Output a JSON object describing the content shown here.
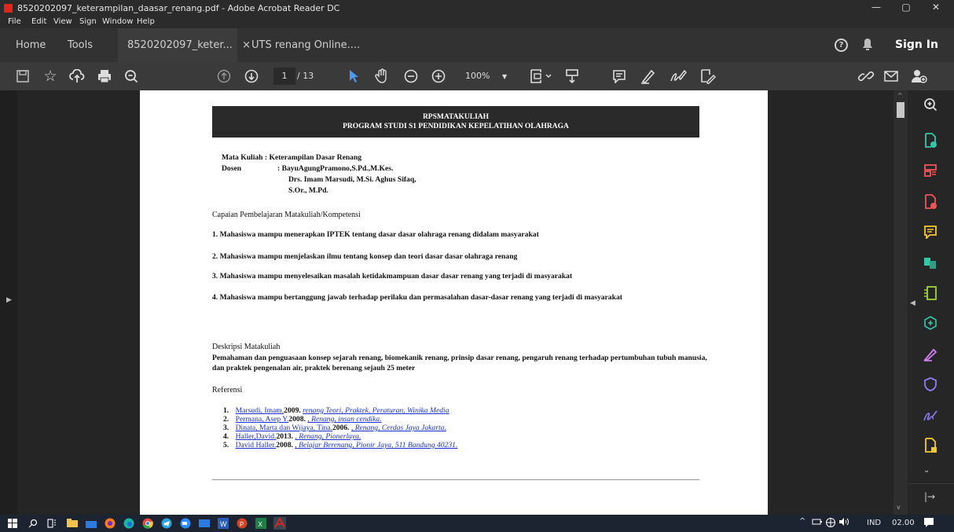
{
  "window": {
    "title": "8520202097_keterampilan_daasar_renang.pdf - Adobe Acrobat Reader DC",
    "minimize": "—",
    "restore": "▢",
    "close": "✕"
  },
  "menu": [
    "File",
    "Edit",
    "View",
    "Sign",
    "Window",
    "Help"
  ],
  "tabs": {
    "home": "Home",
    "tools": "Tools",
    "doc1": "8520202097_keter...",
    "doc1_close": "×",
    "doc2": "UTS renang Online....",
    "help_glyph": "?",
    "sign_in": "Sign In"
  },
  "toolbar": {
    "page_current": "1",
    "page_total": "/ 13",
    "zoom": "100%",
    "icons": [
      "save-icon",
      "bookmark-star-icon",
      "upload-icon",
      "print-icon",
      "search-icon",
      "page-up-icon",
      "page-down-icon",
      "select-arrow-icon",
      "hand-icon",
      "zoom-out-icon",
      "zoom-in-icon",
      "fit-page-icon",
      "read-mode-icon",
      "comment-icon",
      "highlight-icon",
      "sign-icon",
      "fill-sign-icon",
      "link-icon",
      "mail-icon",
      "share-user-icon"
    ]
  },
  "document": {
    "header_title": "RPSMATAKULIAH",
    "header_program": "PROGRAM STUDI S1 PENDIDIKAN KEPELATIHAN OLAHRAGA",
    "mk_label": "Mata Kuliah  :  Keterampilan Dasar Renang",
    "dosen_label": "Dosen",
    "dosen_value": ": BayuAgungPramono,S.Pd.,M.Kes.",
    "dosen_line2": "Drs. Imam Marsudi, M.Si.  Aghus Sifaq,",
    "dosen_line3": "S.Or., M.Pd.",
    "capaian_heading": "Capaian Pembelajaran Matakuliah/Kompetensi",
    "cp": [
      "1.  Mahasiswa mampu menerapkan IPTEK tentang dasar dasar olahraga renang didalam masyarakat",
      "2.  Mahasiswa mampu menjelaskan ilmu tentang konsep dan teori dasar dasar olahraga renang",
      "3.  Mahasiswa mampu menyelesaikan masalah ketidakmampuan dasar dasar renang yang terjadi di masyarakat",
      "4.  Mahasiswa mampu bertanggung jawab terhadap perilaku dan permasalahan dasar-dasar renang yang terjadi  di masyarakat"
    ],
    "deskripsi_heading": "Deskripsi Matakuliah",
    "deskripsi_line1": "Pemahaman dan penguasaan konsep sejarah renang, biomekanik renang, prinsip dasar renang, pengaruh renang   terhadap pertumbuhan tubuh manusia,",
    "deskripsi_line2": "dan praktek pengenalan air, praktek berenang sejauh 25 meter",
    "referensi_heading": "Referensi",
    "refs": [
      {
        "num": "1.",
        "author": "Marsudi, Imam.",
        "year": "2009.",
        "title": "renang Teori, Praktek, Peraturan, Winika Media"
      },
      {
        "num": "2.",
        "author": "Permana, Asep Y.",
        "year": "2008.",
        "title": ", Renang, insan cendika."
      },
      {
        "num": "3.",
        "author": "Dinata, Marta dan Wijaya, Tina.",
        "year": "2006.",
        "title": ", Renang, Cerdas Jaya Jakarta."
      },
      {
        "num": "4.",
        "author": "Haller,David.",
        "year": "2013.",
        "title": ", Renang, Pionerlaya."
      },
      {
        "num": "5.",
        "author": "David Haller.",
        "year": "2008.",
        "title": ", Belajar Berenang, Pionir Jaya, 511 Bandung 40231."
      }
    ]
  },
  "right_panel": [
    "zoom-icon",
    "export-pdf-icon",
    "organize-pages-icon",
    "create-pdf-icon",
    "comment-icon",
    "combine-files-icon",
    "compress-icon",
    "convert-icon",
    "fill-sign-icon",
    "protect-icon",
    "sign-icon",
    "more-tools-icon",
    "expand-icon"
  ],
  "taskbar": {
    "lang": "IND",
    "time": "02.00"
  },
  "colors": {
    "accent": "#e0251b",
    "link": "#1a2fd6"
  }
}
